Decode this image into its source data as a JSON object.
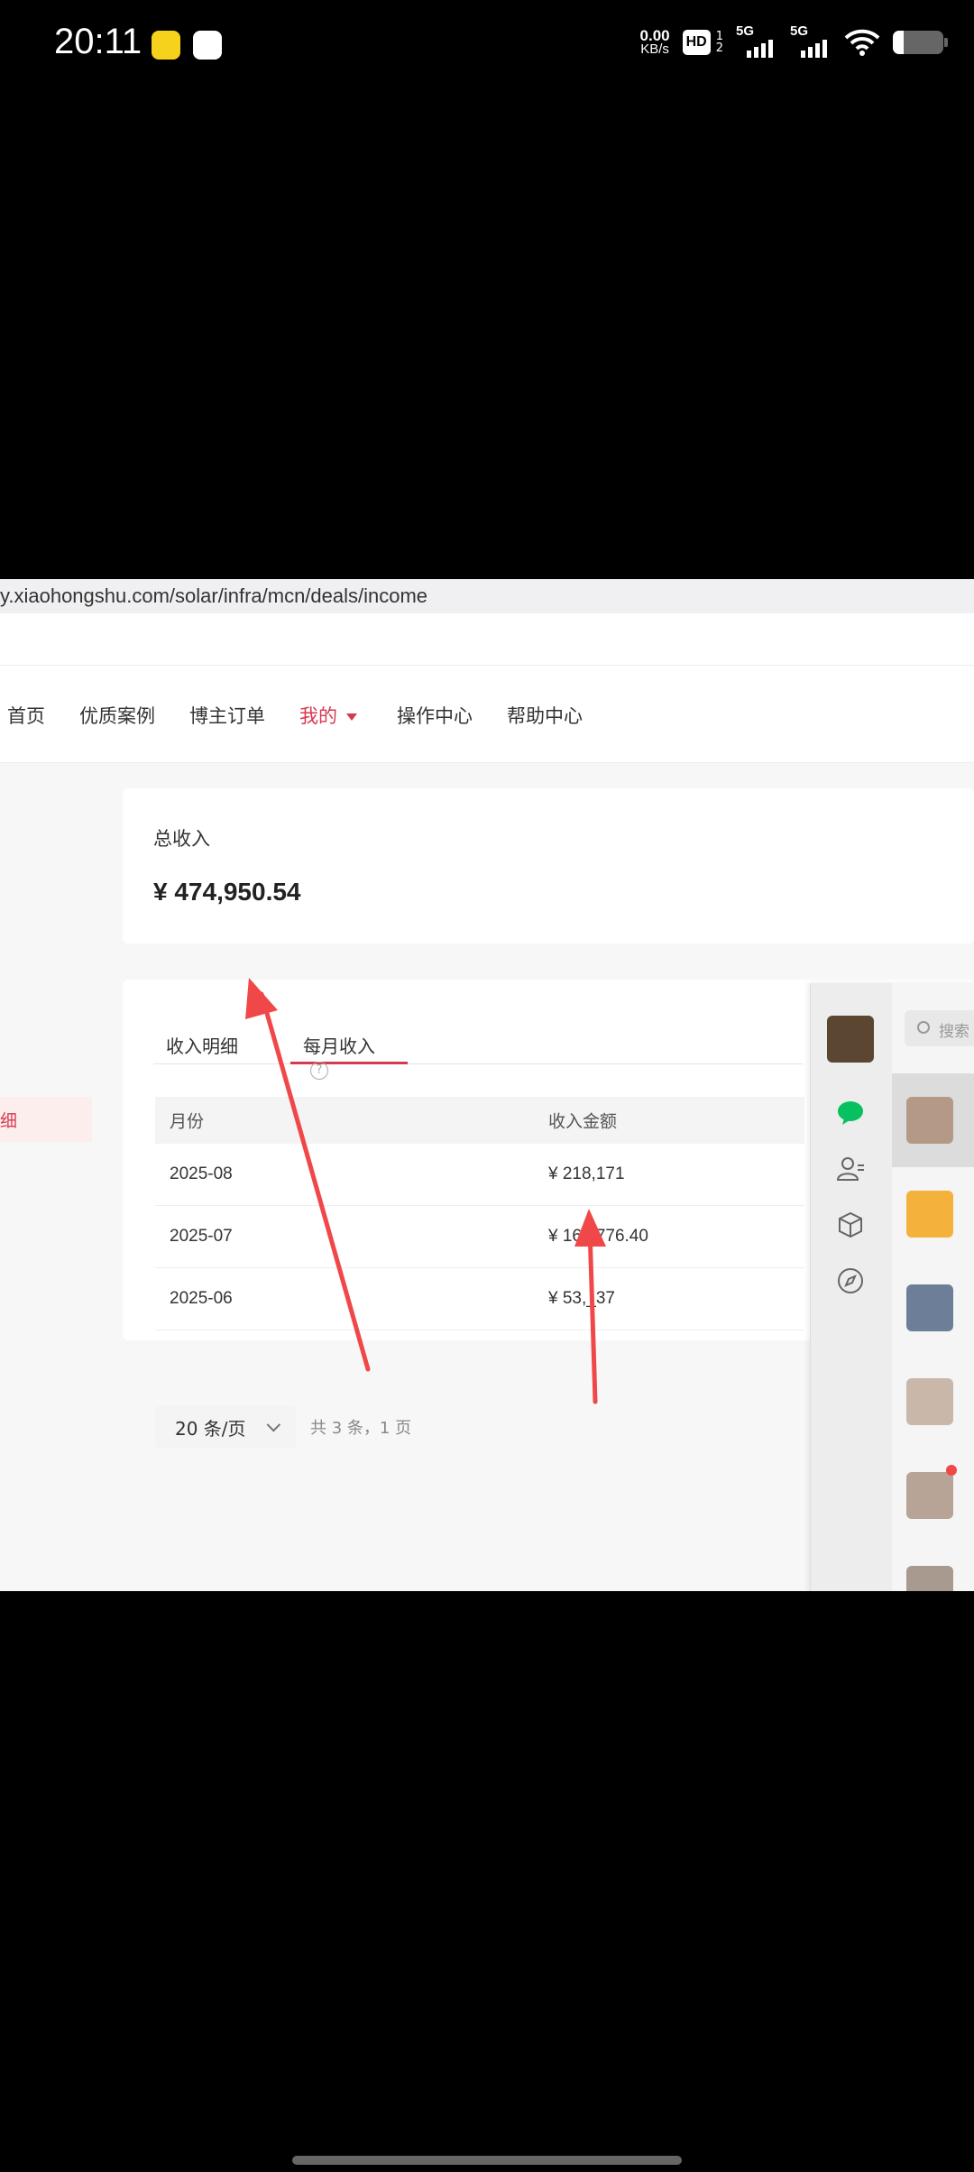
{
  "status_bar": {
    "time": "20:11",
    "net_speed_value": "0.00",
    "net_speed_unit": "KB/s",
    "hd_label": "HD",
    "hd_sub_top": "1",
    "hd_sub_bottom": "2",
    "signal1": "5G",
    "signal2": "5G"
  },
  "browser": {
    "url": "y.xiaohongshu.com/solar/infra/mcn/deals/income"
  },
  "nav": {
    "items": [
      "首页",
      "优质案例",
      "博主订单",
      "我的",
      "操作中心",
      "帮助中心"
    ],
    "active_index": 3
  },
  "sidebar": {
    "active_item_fragment": "细"
  },
  "summary": {
    "total_label": "总收入",
    "total_amount": "¥ 474,950.54"
  },
  "detail": {
    "tabs": [
      "收入明细",
      "每月收入"
    ],
    "active_tab": 1,
    "table_headers": [
      "月份",
      "收入金额"
    ],
    "rows": [
      {
        "month": "2025-08",
        "amount": "¥ 218,171"
      },
      {
        "month": "2025-07",
        "amount": "¥ 16_,776.40"
      },
      {
        "month": "2025-06",
        "amount": "¥ 53,_37"
      }
    ],
    "page_size_label": "20 条/页",
    "pager_info": "共 3 条，1 页"
  },
  "chat": {
    "search_placeholder": "搜索"
  },
  "colors": {
    "accent": "#d6394f",
    "arrow": "#f04848",
    "chat_green": "#07c160"
  }
}
